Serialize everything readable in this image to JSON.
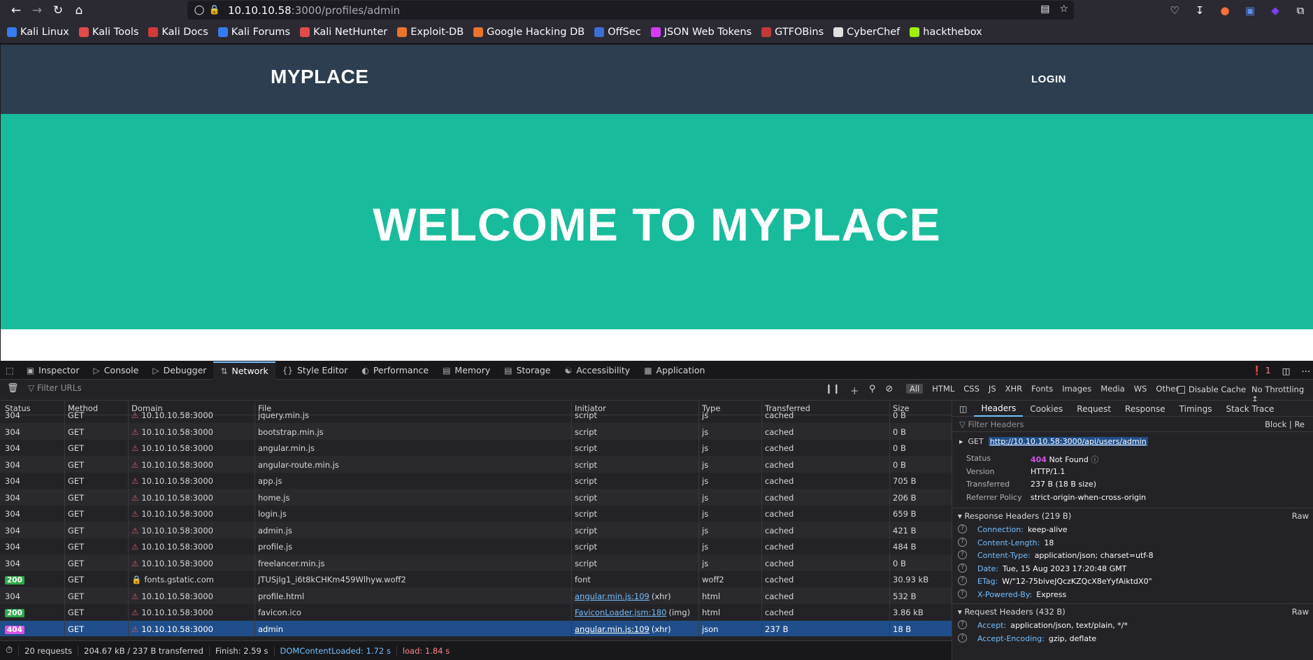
{
  "browser": {
    "url_host": "10.10.10.58",
    "url_path": ":3000/profiles/admin",
    "bookmarks": [
      "Kali Linux",
      "Kali Tools",
      "Kali Docs",
      "Kali Forums",
      "Kali NetHunter",
      "Exploit-DB",
      "Google Hacking DB",
      "OffSec",
      "JSON Web Tokens",
      "GTFOBins",
      "CyberChef",
      "hackthebox"
    ],
    "bookmark_colors": [
      "#367bf0",
      "#e04b4b",
      "#d33a3a",
      "#367bf0",
      "#e04b4b",
      "#e8742e",
      "#e8742e",
      "#3b6fd6",
      "#d63aff",
      "#c23b3b",
      "#e0e0e0",
      "#9fef00"
    ]
  },
  "site": {
    "brand": "MYPLACE",
    "login": "LOGIN",
    "hero_title": "WELCOME TO MYPLACE",
    "colors": {
      "nav": "#2c3e50",
      "hero": "#18bc9c"
    }
  },
  "devtools": {
    "tabs": [
      "Inspector",
      "Console",
      "Debugger",
      "Network",
      "Style Editor",
      "Performance",
      "Memory",
      "Storage",
      "Accessibility",
      "Application"
    ],
    "active_tab": "Network",
    "error_count": "1",
    "filter_placeholder": "Filter URLs",
    "type_filters": [
      "All",
      "HTML",
      "CSS",
      "JS",
      "XHR",
      "Fonts",
      "Images",
      "Media",
      "WS",
      "Other"
    ],
    "disable_cache": "Disable Cache",
    "throttling": "No Throttling",
    "columns": [
      "Status",
      "Method",
      "Domain",
      "File",
      "Initiator",
      "Type",
      "Transferred",
      "Size"
    ],
    "requests": [
      {
        "status": "304",
        "method": "GET",
        "domain": "10.10.10.58:3000",
        "file": "jquery.min.js",
        "initiator": "script",
        "type": "js",
        "transferred": "cached",
        "size": "0 B"
      },
      {
        "status": "304",
        "method": "GET",
        "domain": "10.10.10.58:3000",
        "file": "bootstrap.min.js",
        "initiator": "script",
        "type": "js",
        "transferred": "cached",
        "size": "0 B"
      },
      {
        "status": "304",
        "method": "GET",
        "domain": "10.10.10.58:3000",
        "file": "angular.min.js",
        "initiator": "script",
        "type": "js",
        "transferred": "cached",
        "size": "0 B"
      },
      {
        "status": "304",
        "method": "GET",
        "domain": "10.10.10.58:3000",
        "file": "angular-route.min.js",
        "initiator": "script",
        "type": "js",
        "transferred": "cached",
        "size": "0 B"
      },
      {
        "status": "304",
        "method": "GET",
        "domain": "10.10.10.58:3000",
        "file": "app.js",
        "initiator": "script",
        "type": "js",
        "transferred": "cached",
        "size": "705 B"
      },
      {
        "status": "304",
        "method": "GET",
        "domain": "10.10.10.58:3000",
        "file": "home.js",
        "initiator": "script",
        "type": "js",
        "transferred": "cached",
        "size": "206 B"
      },
      {
        "status": "304",
        "method": "GET",
        "domain": "10.10.10.58:3000",
        "file": "login.js",
        "initiator": "script",
        "type": "js",
        "transferred": "cached",
        "size": "659 B"
      },
      {
        "status": "304",
        "method": "GET",
        "domain": "10.10.10.58:3000",
        "file": "admin.js",
        "initiator": "script",
        "type": "js",
        "transferred": "cached",
        "size": "421 B"
      },
      {
        "status": "304",
        "method": "GET",
        "domain": "10.10.10.58:3000",
        "file": "profile.js",
        "initiator": "script",
        "type": "js",
        "transferred": "cached",
        "size": "484 B"
      },
      {
        "status": "304",
        "method": "GET",
        "domain": "10.10.10.58:3000",
        "file": "freelancer.min.js",
        "initiator": "script",
        "type": "js",
        "transferred": "cached",
        "size": "0 B"
      },
      {
        "status": "200",
        "method": "GET",
        "domain": "fonts.gstatic.com",
        "file": "JTUSjIg1_i6t8kCHKm459Wlhyw.woff2",
        "initiator": "font",
        "type": "woff2",
        "transferred": "cached",
        "size": "30.93 kB"
      },
      {
        "status": "304",
        "method": "GET",
        "domain": "10.10.10.58:3000",
        "file": "profile.html",
        "initiator": "angular.min.js:109",
        "initiator_suffix": "(xhr)",
        "type": "html",
        "transferred": "cached",
        "size": "532 B"
      },
      {
        "status": "200",
        "method": "GET",
        "domain": "10.10.10.58:3000",
        "file": "favicon.ico",
        "initiator": "FaviconLoader.jsm:180",
        "initiator_suffix": "(img)",
        "type": "html",
        "transferred": "cached",
        "size": "3.86 kB"
      },
      {
        "status": "404",
        "method": "GET",
        "domain": "10.10.10.58:3000",
        "file": "admin",
        "initiator": "angular.min.js:109",
        "initiator_suffix": "(xhr)",
        "type": "json",
        "transferred": "237 B",
        "size": "18 B",
        "selected": true
      }
    ],
    "status_bar": {
      "requests": "20 requests",
      "transferred": "204.67 kB / 237 B transferred",
      "finish": "Finish: 2.59 s",
      "dom_loaded": "DOMContentLoaded: 1.72 s",
      "load": "load: 1.84 s"
    },
    "panel": {
      "tabs": [
        "Headers",
        "Cookies",
        "Request",
        "Response",
        "Timings",
        "Stack Trace"
      ],
      "active_tab": "Headers",
      "filter_placeholder": "Filter Headers",
      "block": "Block",
      "resend": "Re",
      "method": "GET",
      "url": "http://10.10.10.58:3000/api/users/admin",
      "status_label": "Status",
      "status_code": "404",
      "status_text": "Not Found",
      "version_label": "Version",
      "version": "HTTP/1.1",
      "transferred_label": "Transferred",
      "transferred": "237 B (18 B size)",
      "referrer_label": "Referrer Policy",
      "referrer": "strict-origin-when-cross-origin",
      "response_headers_title": "Response Headers (219 B)",
      "raw": "Raw",
      "response_headers": [
        {
          "name": "Connection:",
          "value": "keep-alive"
        },
        {
          "name": "Content-Length:",
          "value": "18"
        },
        {
          "name": "Content-Type:",
          "value": "application/json; charset=utf-8"
        },
        {
          "name": "Date:",
          "value": "Tue, 15 Aug 2023 17:20:48 GMT"
        },
        {
          "name": "ETag:",
          "value": "W/\"12-75biveJQczKZQcX8eYyfAiktdX0\""
        },
        {
          "name": "X-Powered-By:",
          "value": "Express"
        }
      ],
      "request_headers_title": "Request Headers (432 B)",
      "request_headers": [
        {
          "name": "Accept:",
          "value": "application/json, text/plain, */*"
        },
        {
          "name": "Accept-Encoding:",
          "value": "gzip, deflate"
        }
      ]
    }
  }
}
